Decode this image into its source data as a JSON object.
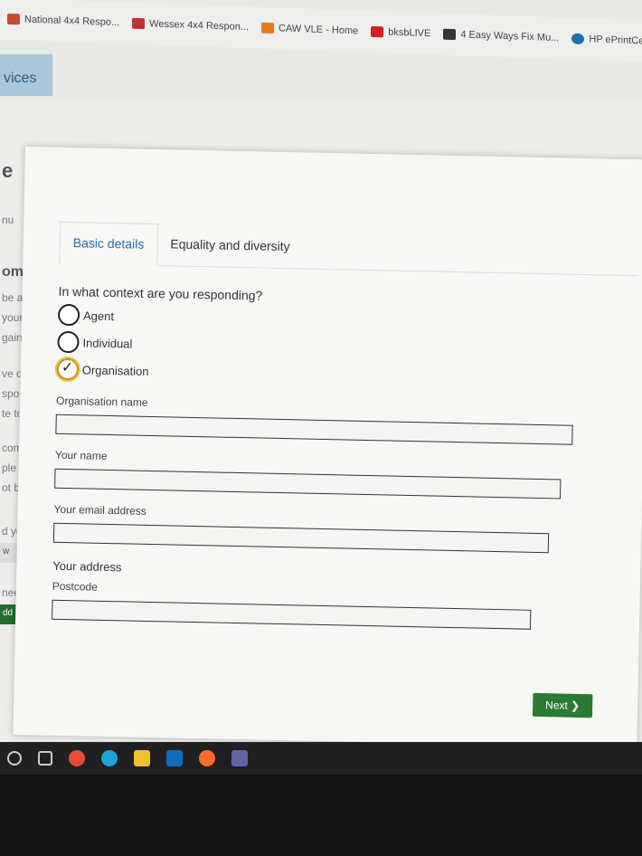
{
  "bookmarks": [
    {
      "label": "National 4x4 Respo...",
      "icon": "flag-icon",
      "color": "#c84a2a"
    },
    {
      "label": "Wessex 4x4 Respon...",
      "icon": "flag-icon",
      "color": "#b33"
    },
    {
      "label": "CAW VLE - Home",
      "icon": "moodle-icon",
      "color": "#e07b1e"
    },
    {
      "label": "bksbLIVE",
      "icon": "bksb-icon",
      "color": "#c22"
    },
    {
      "label": "4 Easy Ways Fix Mu...",
      "icon": "page-icon",
      "color": "#333"
    },
    {
      "label": "HP ePrintCe",
      "icon": "hp-icon",
      "color": "#1f6fb5"
    }
  ],
  "background": {
    "services_tab": "vices",
    "title_fragment": "e",
    "frag_nu": "nu",
    "frag_ome": "ome",
    "lines": [
      "be ab",
      "your",
      "gain.",
      "ve des",
      "spons",
      "te to th",
      "comm",
      "ple in w",
      "ot be sa",
      "d you lik",
      "need to c"
    ],
    "buttons": [
      "w",
      "Vi",
      "dd person"
    ]
  },
  "modal": {
    "tabs": [
      "Basic details",
      "Equality and diversity"
    ],
    "question": "In what context are you responding?",
    "options": [
      "Agent",
      "Individual",
      "Organisation"
    ],
    "selected_option": "Organisation",
    "fields": {
      "org_name_label": "Organisation name",
      "your_name_label": "Your name",
      "email_label": "Your email address",
      "address_title": "Your address",
      "postcode_label": "Postcode"
    },
    "next_button": "Next ❯"
  },
  "colors": {
    "accent_blue": "#2a6ead",
    "next_green": "#2a7a33",
    "selected_ring": "#c99516"
  }
}
